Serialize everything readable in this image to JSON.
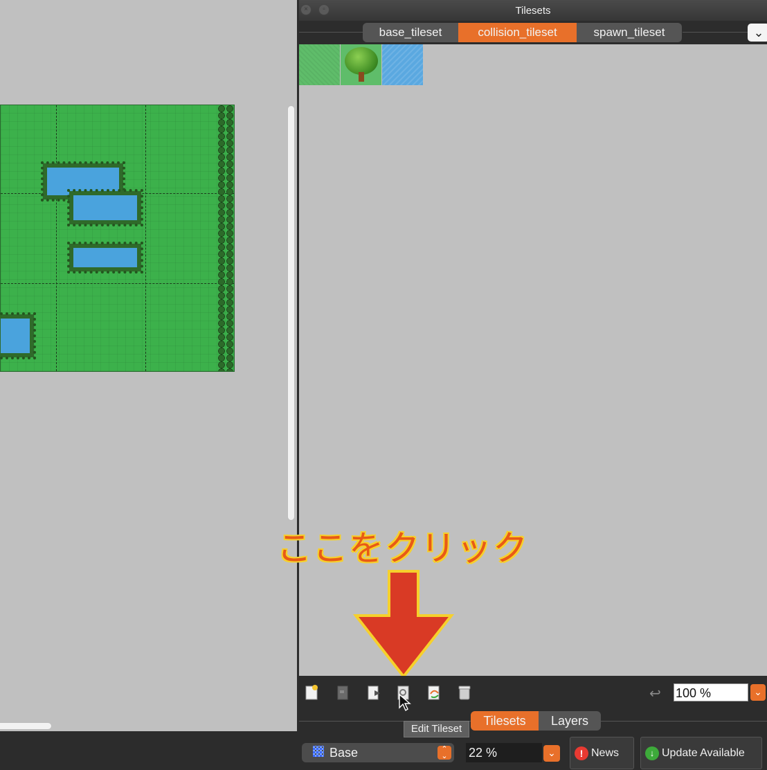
{
  "panel": {
    "title": "Tilesets",
    "tabs": [
      {
        "label": "base_tileset",
        "active": false
      },
      {
        "label": "collision_tileset",
        "active": true
      },
      {
        "label": "spawn_tileset",
        "active": false
      }
    ],
    "tiles": [
      "grass",
      "tree",
      "water"
    ]
  },
  "annotation": {
    "text": "ここをクリック",
    "color": "#e85a16",
    "outline_color": "#f6d02c",
    "arrow_color": "#d93a25"
  },
  "toolbar": {
    "icons": [
      "new-tileset-icon",
      "embed-tileset-icon",
      "export-tileset-icon",
      "edit-tileset-icon",
      "replace-tileset-icon",
      "delete-tileset-icon"
    ],
    "tooltip": "Edit Tileset",
    "zoom_value": "100 %"
  },
  "bottom_tabs": [
    {
      "label": "Tilesets",
      "active": true
    },
    {
      "label": "Layers",
      "active": false
    }
  ],
  "statusbar": {
    "layer_label": "Base",
    "map_zoom": "22 %",
    "news_label": "News",
    "update_label": "Update Available"
  },
  "colors": {
    "accent": "#e8702a",
    "grass": "#3cb14b",
    "water": "#4aa3dd"
  }
}
